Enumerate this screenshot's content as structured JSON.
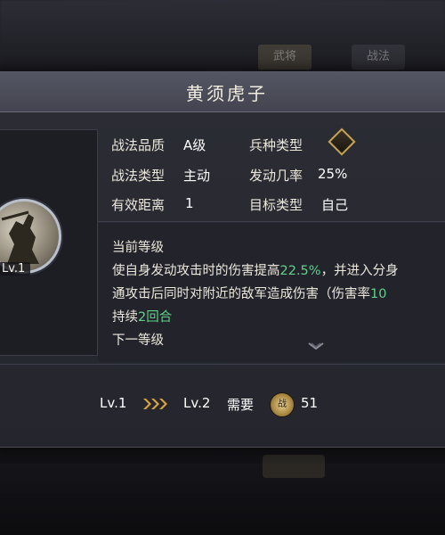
{
  "background": {
    "tab1": "武将",
    "tab2": "战法"
  },
  "panel": {
    "title": "黄须虎子"
  },
  "portrait": {
    "level_badge": "Lv.1"
  },
  "attributes": {
    "quality_label": "战法品质",
    "quality_value": "A级",
    "type_label": "战法类型",
    "type_value": "主动",
    "range_label": "有效距离",
    "range_value": "1",
    "troop_label": "兵种类型",
    "rate_label": "发动几率",
    "rate_value": "25%",
    "target_label": "目标类型",
    "target_value": "自己"
  },
  "description": {
    "current_header": "当前等级",
    "line1_a": "使自身发动攻击时的伤害提高",
    "line1_pct": "22.5%",
    "line1_b": "，并进入分身",
    "line2_a": "通攻击后同时对附近的敌军造成伤害（伤害率",
    "line2_num": "10",
    "line3_a": "持续",
    "line3_num": "2回合",
    "next_header": "下一等级"
  },
  "upgrade": {
    "from_level": "Lv.1",
    "to_level": "Lv.2",
    "need_label": "需要",
    "cost_icon_text": "战",
    "cost_value": "51"
  },
  "colors": {
    "highlight_green": "#5fd28a",
    "gold": "#c9a451"
  },
  "icons": {
    "troop_type": "troop-type-diamond-icon",
    "upgrade_arrows": "triple-chevron-right-icon",
    "cost": "tactic-point-coin-icon",
    "expand": "chevron-down-icon"
  }
}
